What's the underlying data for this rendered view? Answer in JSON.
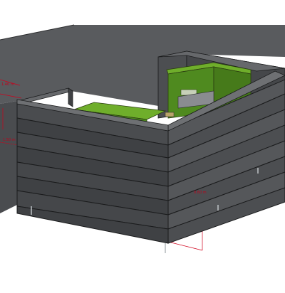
{
  "app": {
    "view": "3D perspective",
    "render_style": "shaded with edges"
  },
  "scene": {
    "model": "slatted dark-grey enclosure with green bin lids",
    "colors": {
      "background": "#ffffff",
      "wall_top": "#595b5e",
      "wall_side": "#4c4e51",
      "slat_face": "#3f4144",
      "slat_edge": "#1a1b1c",
      "bin_green": "#4f8a1f",
      "bin_green_light": "#6fae2b",
      "dimension_line": "#d0001c",
      "post_metal": "#b8bcc0"
    },
    "dimensions": [
      {
        "label": "1.40 m"
      },
      {
        "label": "1.50 m"
      },
      {
        "label": "0.60 m"
      }
    ]
  }
}
